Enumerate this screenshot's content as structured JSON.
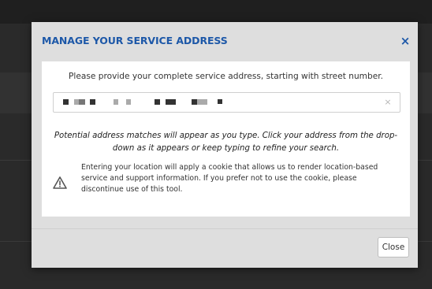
{
  "modal": {
    "title": "MANAGE YOUR SERVICE ADDRESS",
    "close_icon_glyph": "×",
    "instructions": "Please provide your complete service address, starting with street number.",
    "address_input": {
      "value": "",
      "placeholder": "",
      "clear_glyph": "×"
    },
    "matches_text": "Potential address matches will appear as you type. Click your address from the drop-down as it appears or keep typing to refine your search.",
    "cookie_notice": "Entering your location will apply a cookie that allows us to render location-based service and support information. If you prefer not to use the cookie, please discontinue use of this tool.",
    "close_button_label": "Close"
  },
  "icons": {
    "close": "close-icon",
    "clear": "clear-icon",
    "warning": "warning-icon"
  },
  "colors": {
    "title": "#1d58a8",
    "backdrop": "#2a2a2a",
    "modal_bg": "#dedede",
    "body_bg": "#ffffff"
  }
}
